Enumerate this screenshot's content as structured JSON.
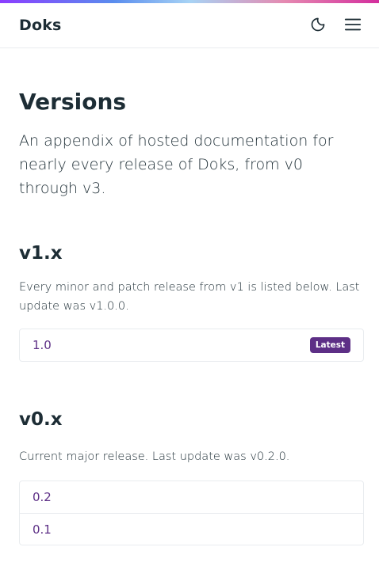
{
  "header": {
    "brand": "Doks",
    "icons": {
      "theme_toggle": "moon-icon",
      "menu": "hamburger-menu-icon"
    }
  },
  "page": {
    "title": "Versions",
    "lead": "An appendix of hosted documentation for nearly every release of Doks, from v0 through v3."
  },
  "sections": [
    {
      "title": "v1.x",
      "description": "Every minor and patch release from v1 is listed below. Last update was v1.0.0.",
      "versions": [
        {
          "label": "1.0",
          "badge": "Latest"
        }
      ]
    },
    {
      "title": "v0.x",
      "description": "Current major release. Last update was v0.2.0.",
      "versions": [
        {
          "label": "0.2"
        },
        {
          "label": "0.1"
        }
      ]
    }
  ],
  "colors": {
    "accent": "#5d2f86",
    "text": "#1d2d35",
    "border": "#e9ecef"
  }
}
